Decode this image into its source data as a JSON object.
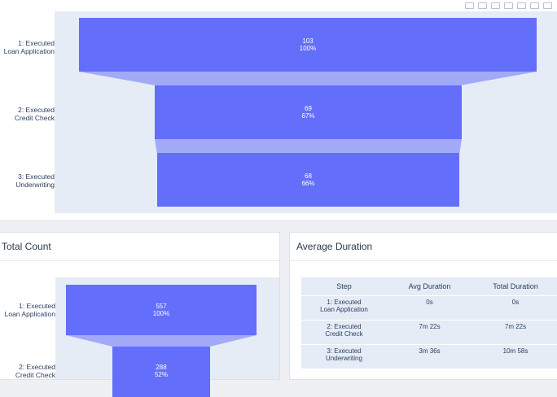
{
  "funnel_top": {
    "steps": [
      {
        "label": "1: Executed\nLoan Application",
        "value": "103",
        "percent": "100%"
      },
      {
        "label": "2: Executed\nCredit Check",
        "value": "69",
        "percent": "67%"
      },
      {
        "label": "3: Executed\nUnderwriting",
        "value": "68",
        "percent": "66%"
      }
    ]
  },
  "total_count": {
    "title": "Total Count",
    "steps": [
      {
        "label": "1: Executed\nLoan Application",
        "value": "557",
        "percent": "100%"
      },
      {
        "label": "2: Executed\nCredit Check",
        "value": "288",
        "percent": "52%"
      }
    ]
  },
  "average_duration": {
    "title": "Average Duration",
    "columns": [
      "Step",
      "Avg Duration",
      "Total Duration"
    ],
    "rows": [
      {
        "step": "1: Executed\nLoan Application",
        "avg": "0s",
        "total": "0s"
      },
      {
        "step": "2: Executed\nCredit Check",
        "avg": "7m 22s",
        "total": "7m 22s"
      },
      {
        "step": "3: Executed\nUnderwriting",
        "avg": "3m 36s",
        "total": "10m 58s"
      }
    ]
  },
  "colors": {
    "bar": "#636efa",
    "connector": "#a2aaf8",
    "plot_bg": "#e5ecf6"
  },
  "chart_data": [
    {
      "type": "bar",
      "orientation": "funnel",
      "categories": [
        "1: Executed Loan Application",
        "2: Executed Credit Check",
        "3: Executed Underwriting"
      ],
      "values": [
        103,
        69,
        68
      ],
      "percent_initial": [
        100,
        67,
        66
      ]
    },
    {
      "type": "bar",
      "orientation": "funnel",
      "title": "Total Count",
      "categories": [
        "1: Executed Loan Application",
        "2: Executed Credit Check"
      ],
      "values": [
        557,
        288
      ],
      "percent_initial": [
        100,
        52
      ]
    }
  ]
}
